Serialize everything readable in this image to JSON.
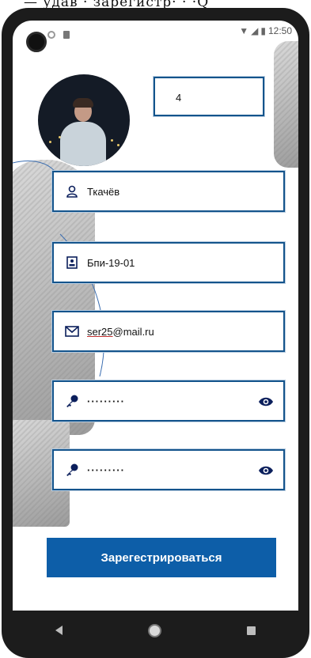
{
  "top_strip_text": "— удав · зарегистр·  ·   ·Q",
  "status": {
    "time": "12:50"
  },
  "header": {
    "counter_value": "4"
  },
  "form": {
    "surname": {
      "value": "Ткачёв",
      "icon": "person-icon"
    },
    "group": {
      "value": "Бпи-19-01",
      "icon": "id-card-icon"
    },
    "email": {
      "value_user": "ser25",
      "value_domain": "@mail.ru",
      "icon": "mail-icon"
    },
    "password": {
      "value": "·········",
      "icon": "key-icon",
      "toggle_icon": "eye-icon"
    },
    "password_confirm": {
      "value": "·········",
      "icon": "key-icon",
      "toggle_icon": "eye-icon"
    }
  },
  "actions": {
    "register_label": "Зарегестрироваться"
  },
  "colors": {
    "accent": "#0d5ea8",
    "border": "#14548c"
  }
}
